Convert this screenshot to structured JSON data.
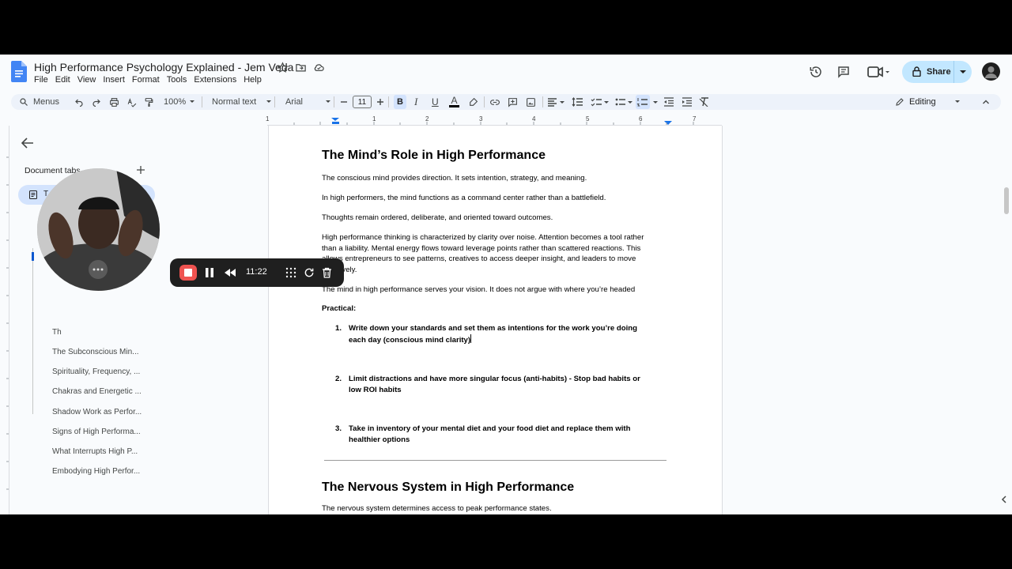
{
  "doc": {
    "title": "High Performance Psychology Explained - Jem Veda",
    "menu": [
      "File",
      "Edit",
      "View",
      "Insert",
      "Format",
      "Tools",
      "Extensions",
      "Help"
    ]
  },
  "header": {
    "share_label": "Share"
  },
  "toolbar": {
    "menus_label": "Menus",
    "zoom": "100%",
    "style": "Normal text",
    "font": "Arial",
    "font_size": "11",
    "bold_label": "B",
    "italic_label": "I",
    "underline_label": "U",
    "text_color_label": "A",
    "mode": "Editing"
  },
  "ruler": {
    "marks": [
      "1",
      "1",
      "2",
      "3",
      "4",
      "5",
      "6",
      "7"
    ]
  },
  "sidebar": {
    "heading": "Document tabs",
    "tab_label": "T",
    "outline_partial": "Th",
    "outline": [
      "The Subconscious Min...",
      "Spirituality, Frequency, ...",
      "Chakras and Energetic ...",
      "Shadow Work as Perfor...",
      "Signs of High Performa...",
      "What Interrupts High P...",
      "Embodying High Perfor..."
    ]
  },
  "recorder": {
    "time": "11:22"
  },
  "content": {
    "h1": "The Mind’s Role in High Performance",
    "p1": "The conscious mind provides direction. It sets intention, strategy, and meaning.",
    "p2": "In high performers, the mind functions as a command center rather than a battlefield.",
    "p3": "Thoughts remain ordered, deliberate, and oriented toward outcomes.",
    "p4_l1": "High performance thinking is characterized by clarity over noise. Attention becomes a tool rather",
    "p4_l2": "than a liability. Mental energy flows toward leverage points rather than scattered reactions. This",
    "p4_l3": "allows entrepreneurs to see patterns, creatives to access deeper insight, and leaders to move",
    "p4_l4": "effectively.",
    "p5": "The mind in high performance serves your vision. It does not argue with where you’re headed",
    "practical": "Practical:",
    "items": [
      {
        "num": "1.",
        "l1": "Write down your standards and set them as intentions for the work you’re doing",
        "l2": "each day (conscious mind clarity)"
      },
      {
        "num": "2.",
        "l1": "Limit distractions and have more singular focus (anti-habits) - Stop bad habits or",
        "l2": "low ROI habits"
      },
      {
        "num": "3.",
        "l1": "Take in inventory of your mental diet and your food diet and replace them with",
        "l2": "healthier options"
      }
    ],
    "h2": "The Nervous System in High Performance",
    "p6": "The nervous system determines access to peak performance states."
  }
}
